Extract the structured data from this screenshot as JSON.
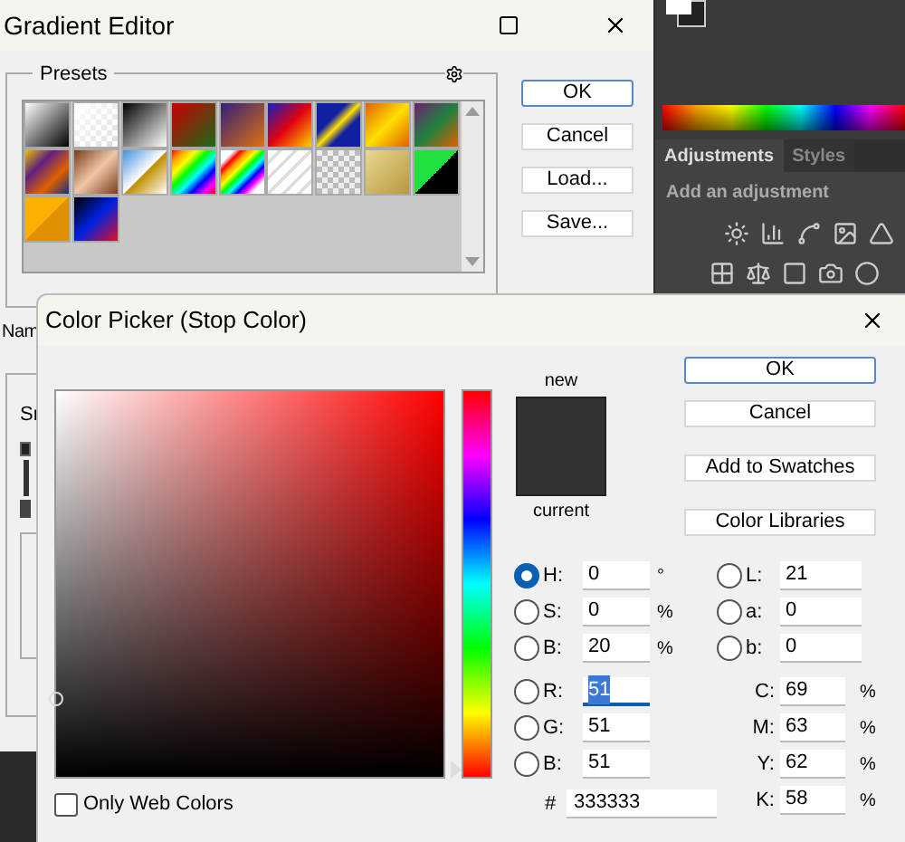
{
  "gradient_editor": {
    "title": "Gradient Editor",
    "presets_label": "Presets",
    "name_label": "Nam",
    "smoothness_label": "Sr",
    "buttons": [
      {
        "label": "OK",
        "default": true
      },
      {
        "label": "Cancel",
        "default": false
      },
      {
        "label": "Load...",
        "default": false
      },
      {
        "label": "Save...",
        "default": false
      }
    ]
  },
  "adjustments_panel": {
    "tabs": [
      {
        "label": "Adjustments",
        "selected": true
      },
      {
        "label": "Styles",
        "selected": false
      }
    ],
    "hint": "Add an adjustment"
  },
  "color_picker": {
    "title": "Color Picker (Stop Color)",
    "new_label": "new",
    "current_label": "current",
    "buttons": [
      {
        "label": "OK",
        "default": true
      },
      {
        "label": "Cancel",
        "default": false
      },
      {
        "label": "Add to Swatches",
        "default": false
      },
      {
        "label": "Color Libraries",
        "default": false
      }
    ],
    "hsb_rgb": [
      {
        "label": "H:",
        "value": "0",
        "unit": "°",
        "selected": true,
        "focused": false
      },
      {
        "label": "S:",
        "value": "0",
        "unit": "%",
        "selected": false,
        "focused": false
      },
      {
        "label": "B:",
        "value": "20",
        "unit": "%",
        "selected": false,
        "focused": false
      },
      {
        "label": "R:",
        "value": "51",
        "selected": false,
        "focused": true
      },
      {
        "label": "G:",
        "value": "51",
        "selected": false,
        "focused": false
      },
      {
        "label": "B:",
        "value": "51",
        "selected": false,
        "focused": false
      }
    ],
    "lab": [
      {
        "label": "L:",
        "value": "21",
        "selected": false
      },
      {
        "label": "a:",
        "value": "0",
        "selected": false
      },
      {
        "label": "b:",
        "value": "0",
        "selected": false
      }
    ],
    "cmyk": [
      {
        "label": "C:",
        "value": "69",
        "unit": "%"
      },
      {
        "label": "M:",
        "value": "63",
        "unit": "%"
      },
      {
        "label": "Y:",
        "value": "62",
        "unit": "%"
      },
      {
        "label": "K:",
        "value": "58",
        "unit": "%"
      }
    ],
    "hue_slider": {
      "level": 0
    },
    "hex_label": "#",
    "hex": "333333",
    "only_web_colors": {
      "label": "Only Web Colors",
      "checked": false
    }
  }
}
